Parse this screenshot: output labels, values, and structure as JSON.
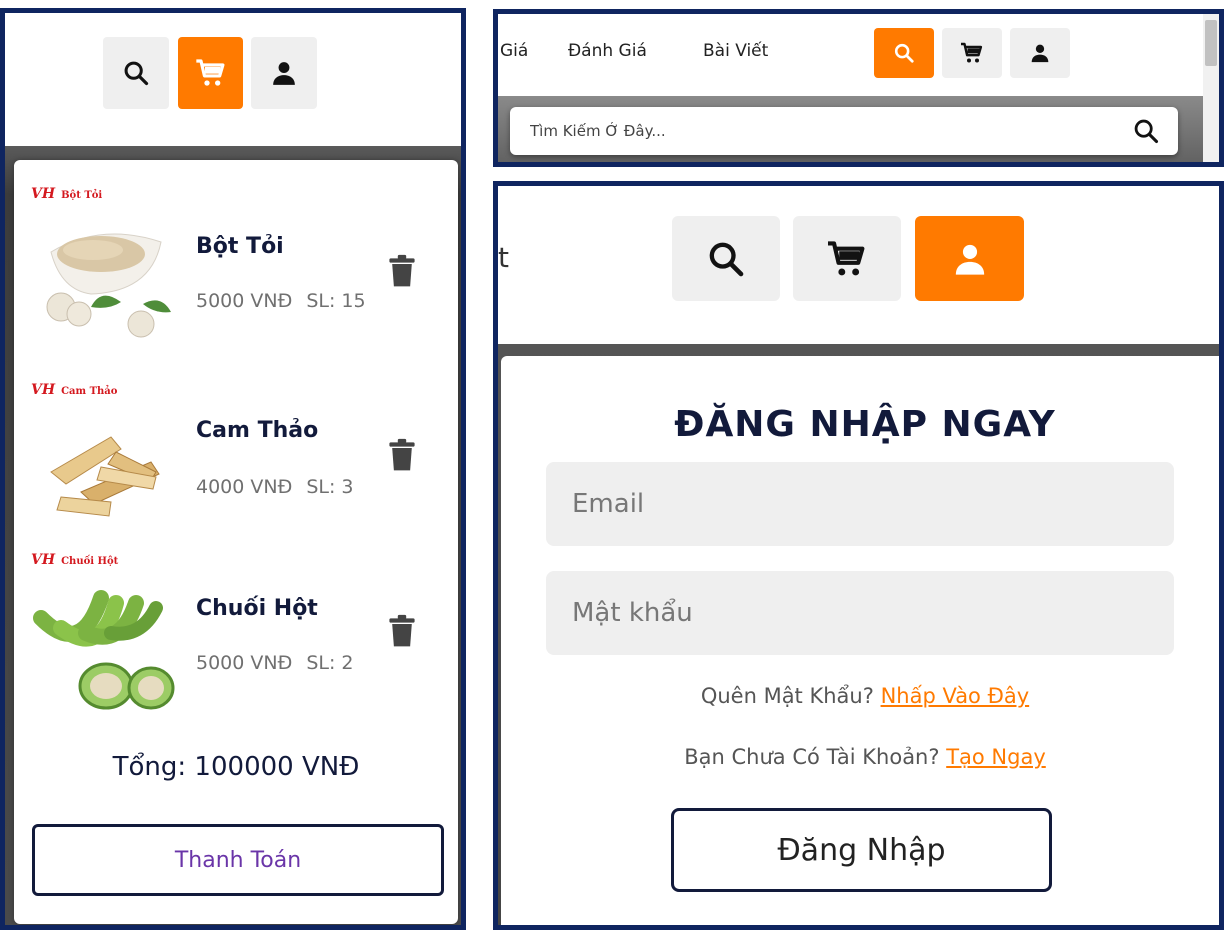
{
  "cart_panel": {
    "items": [
      {
        "brand": "VH",
        "brand_tag": "Bột Tỏi",
        "name": "Bột Tỏi",
        "price": "5000 VNĐ",
        "qty": "SL: 15"
      },
      {
        "brand": "VH",
        "brand_tag": "Cam Thảo",
        "name": "Cam Thảo",
        "price": "4000 VNĐ",
        "qty": "SL: 3"
      },
      {
        "brand": "VH",
        "brand_tag": "Chuối Hột",
        "name": "Chuối Hột",
        "price": "5000 VNĐ",
        "qty": "SL: 2"
      }
    ],
    "total": "Tổng: 100000 VNĐ",
    "checkout_label": "Thanh Toán"
  },
  "search_panel": {
    "nav_links": [
      "Giá",
      "Đánh Giá",
      "Bài Viết"
    ],
    "search_placeholder": "Tìm Kiếm Ở Đây..."
  },
  "login_panel": {
    "nav_fragment": "t",
    "title": "ĐĂNG NHẬP NGAY",
    "email_placeholder": "Email",
    "password_placeholder": "Mật khẩu",
    "forgot_text": "Quên Mật Khẩu? ",
    "forgot_link": "Nhấp Vào Đây",
    "signup_text": "Bạn Chưa Có Tài Khoản? ",
    "signup_link": "Tạo Ngay",
    "login_button": "Đăng Nhập"
  },
  "colors": {
    "accent": "#ff7a00",
    "navy": "#121a3b",
    "frame": "#0f2560"
  },
  "icons": {
    "search": "search-icon",
    "cart": "cart-icon",
    "user": "user-icon",
    "trash": "trash-icon"
  }
}
